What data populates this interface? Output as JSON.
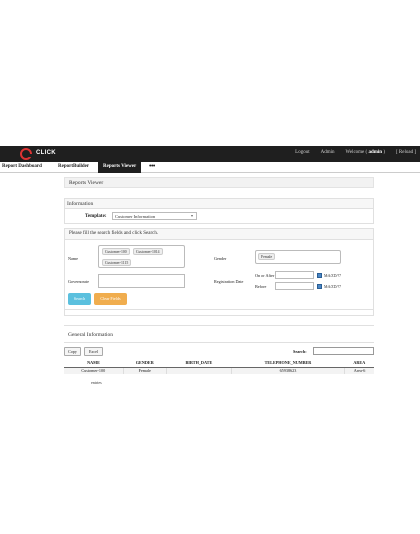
{
  "topbar": {
    "brand": "CLICK",
    "links": [
      "Logout",
      "Admin",
      "Welcome ( admin )",
      "[ Reload ]"
    ],
    "welcome_prefix": "Welcome",
    "welcome_user": "admin"
  },
  "menu": {
    "items": [
      "Report Dashboard",
      "ReportBuilder",
      "Reports Viewer"
    ],
    "active": "Reports Viewer",
    "more": "•••"
  },
  "page_title": "Reports Viewer",
  "information": {
    "header": "Information",
    "template_label": "Template:",
    "template_value": "Customer Information"
  },
  "search": {
    "instruction": "Please fill the search fields and click Search.",
    "name_label": "Name",
    "name_chips": [
      "Customer-100",
      "Customer-1014",
      "Customer-1115"
    ],
    "governorate_label": "Governorate",
    "gender_label": "Gender",
    "gender_chips": [
      "Female"
    ],
    "registration_label": "Registration Date",
    "on_after_label": "On or After",
    "before_label": "Before",
    "date_format": "M/d/ZD/?7",
    "search_button": "Search",
    "clear_button": "Clear Fields"
  },
  "general": {
    "title": "General Information",
    "copy_button": "Copy",
    "excel_button": "Excel",
    "search_label": "Search:",
    "columns": [
      "NAME",
      "GENDER",
      "BIRTH_DATE",
      "TELEPHONE_NUMBER",
      "AREA"
    ],
    "rows": [
      [
        "Customer-100",
        "Female",
        "",
        "65938623",
        "Area-6"
      ]
    ],
    "entries_text": "entries"
  },
  "colors": {
    "topbar": "#1f1f1f",
    "search_button": "#5bc0de",
    "clear_button": "#f0ad4e",
    "logo_ring": "#dd3333"
  }
}
